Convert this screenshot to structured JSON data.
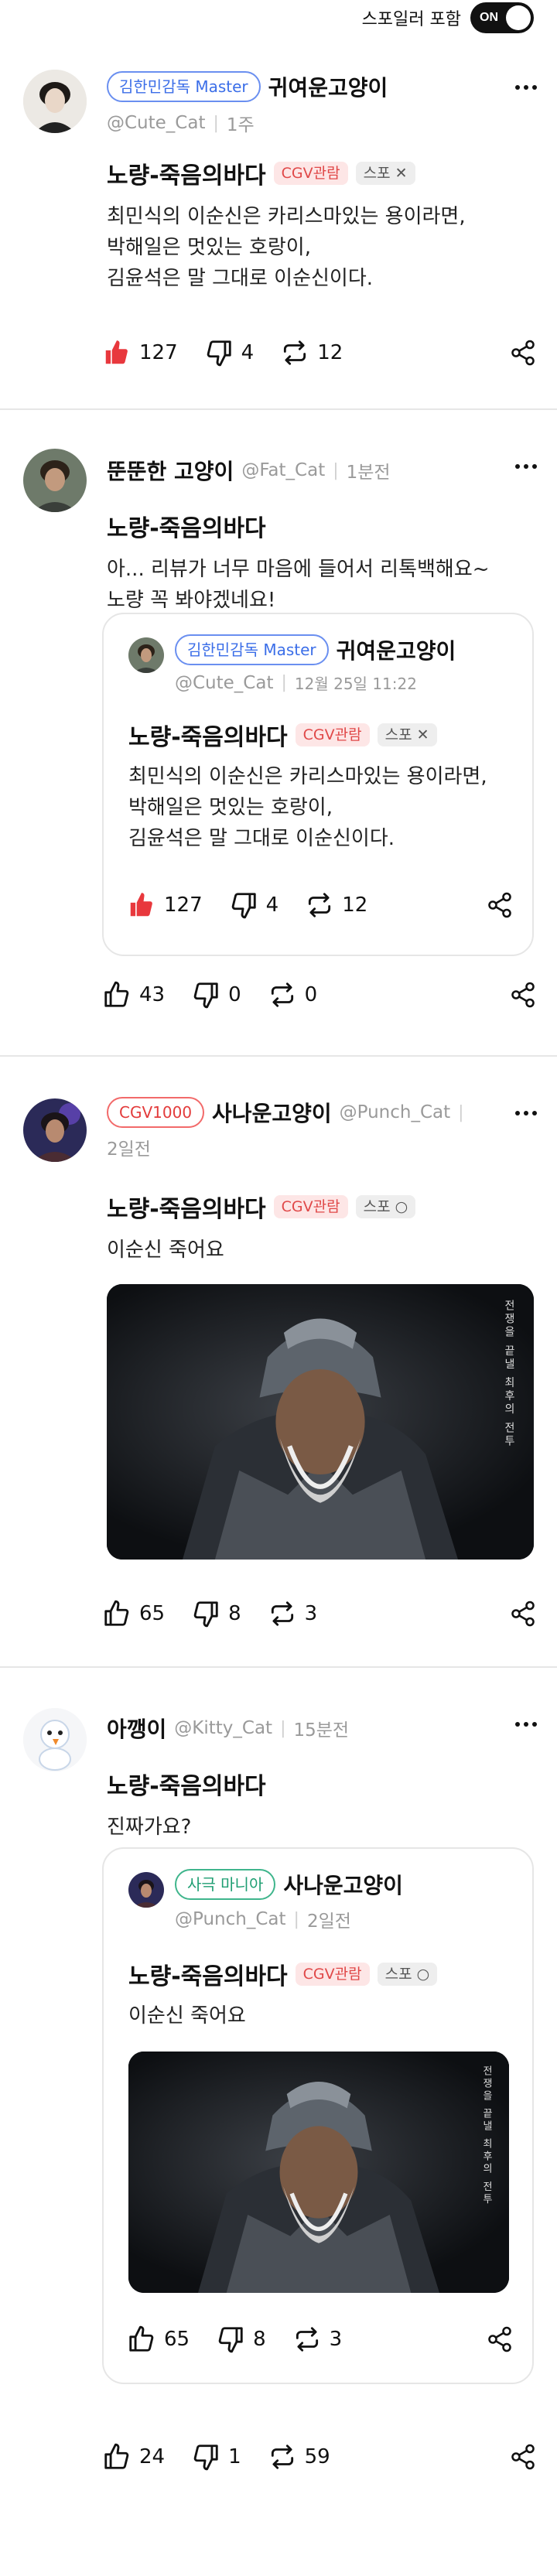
{
  "top_bar": {
    "spoiler_label": "스포일러 포함",
    "toggle_label": "ON"
  },
  "posts": [
    {
      "badge": "김한민감독 Master",
      "nickname": "귀여운고양이",
      "handle": "@Cute_Cat",
      "time": "1주",
      "movie": "노량-죽음의바다",
      "cgv_tag": "CGV관람",
      "spoiler_tag": "스포 ✕",
      "text": "최민식의 이순신은 카리스마있는 용이라면,\n박해일은 멋있는 호랑이,\n김윤석은 말 그대로 이순신이다.",
      "likes": "127",
      "dislikes": "4",
      "reposts": "12",
      "liked": true
    },
    {
      "nickname": "뚠뚠한 고양이",
      "handle": "@Fat_Cat",
      "time": "1분전",
      "movie": "노량-죽음의바다",
      "text": "아... 리뷰가 너무 마음에 들어서 리톡백해요~\n노량 꼭 봐야겠네요!",
      "quote": {
        "badge": "김한민감독 Master",
        "nickname": "귀여운고양이",
        "handle": "@Cute_Cat",
        "time": "12월 25일 11:22",
        "movie": "노량-죽음의바다",
        "cgv_tag": "CGV관람",
        "spoiler_tag": "스포 ✕",
        "text": "최민식의 이순신은 카리스마있는 용이라면,\n박해일은 멋있는 호랑이,\n김윤석은 말 그대로 이순신이다.",
        "likes": "127",
        "dislikes": "4",
        "reposts": "12"
      },
      "likes": "43",
      "dislikes": "0",
      "reposts": "0"
    },
    {
      "badge": "CGV1000",
      "nickname": "사나운고양이",
      "handle": "@Punch_Cat",
      "time": "2일전",
      "movie": "노량-죽음의바다",
      "cgv_tag": "CGV관람",
      "spoiler_tag": "스포 ○",
      "text": "이순신 죽어요",
      "photo_caption": "전쟁을 끝낼 최후의 전투",
      "likes": "65",
      "dislikes": "8",
      "reposts": "3"
    },
    {
      "nickname": "아깽이",
      "handle": "@Kitty_Cat",
      "time": "15분전",
      "movie": "노량-죽음의바다",
      "text": "진짜가요?",
      "quote": {
        "badge": "사극 마니아",
        "nickname": "사나운고양이",
        "handle": "@Punch_Cat",
        "time": "2일전",
        "movie": "노량-죽음의바다",
        "cgv_tag": "CGV관람",
        "spoiler_tag": "스포 ○",
        "text": "이순신 죽어요",
        "photo_caption": "전쟁을 끝낼 최후의 전투",
        "likes": "65",
        "dislikes": "8",
        "reposts": "3"
      },
      "likes": "24",
      "dislikes": "1",
      "reposts": "59"
    }
  ],
  "colors": {
    "like_active": "#e8383d",
    "master_badge": "#3b6ee8",
    "cgv_badge": "#e33b3b",
    "mania_badge": "#1e9e72"
  }
}
